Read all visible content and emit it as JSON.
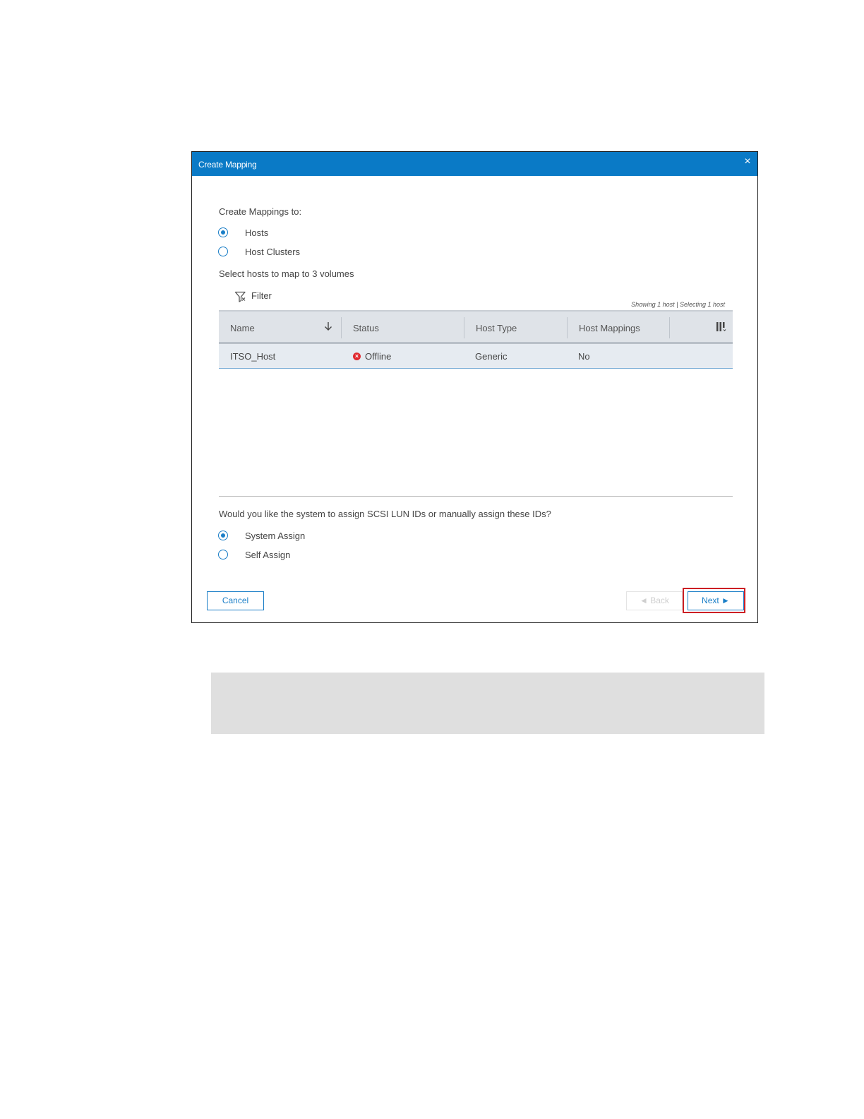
{
  "dialog": {
    "title": "Create Mapping",
    "close_icon": "×"
  },
  "mapping_target": {
    "heading": "Create Mappings to:",
    "options": [
      {
        "label": "Hosts",
        "checked": true
      },
      {
        "label": "Host Clusters",
        "checked": false
      }
    ]
  },
  "select_prompt": "Select hosts to map to 3 volumes",
  "filter": {
    "label": "Filter",
    "icon": "filter-icon"
  },
  "showing_text": "Showing 1 host | Selecting 1 host",
  "table": {
    "columns": [
      "Name",
      "Status",
      "Host Type",
      "Host Mappings"
    ],
    "sort_icon": "arrow-down-icon",
    "column_picker_icon": "columns-icon",
    "rows": [
      {
        "name": "ITSO_Host",
        "status": "Offline",
        "status_color": "#e0282e",
        "host_type": "Generic",
        "host_mappings": "No"
      }
    ]
  },
  "lun_assignment": {
    "question": "Would you like the system to assign SCSI LUN IDs or manually assign these IDs?",
    "options": [
      {
        "label": "System Assign",
        "checked": true
      },
      {
        "label": "Self Assign",
        "checked": false
      }
    ]
  },
  "buttons": {
    "cancel": "Cancel",
    "back": "◄ Back",
    "next": "Next ►"
  },
  "colors": {
    "title_bar": "#0a7ac6",
    "accent": "#1a7ec7",
    "highlight": "#cc1f24"
  }
}
